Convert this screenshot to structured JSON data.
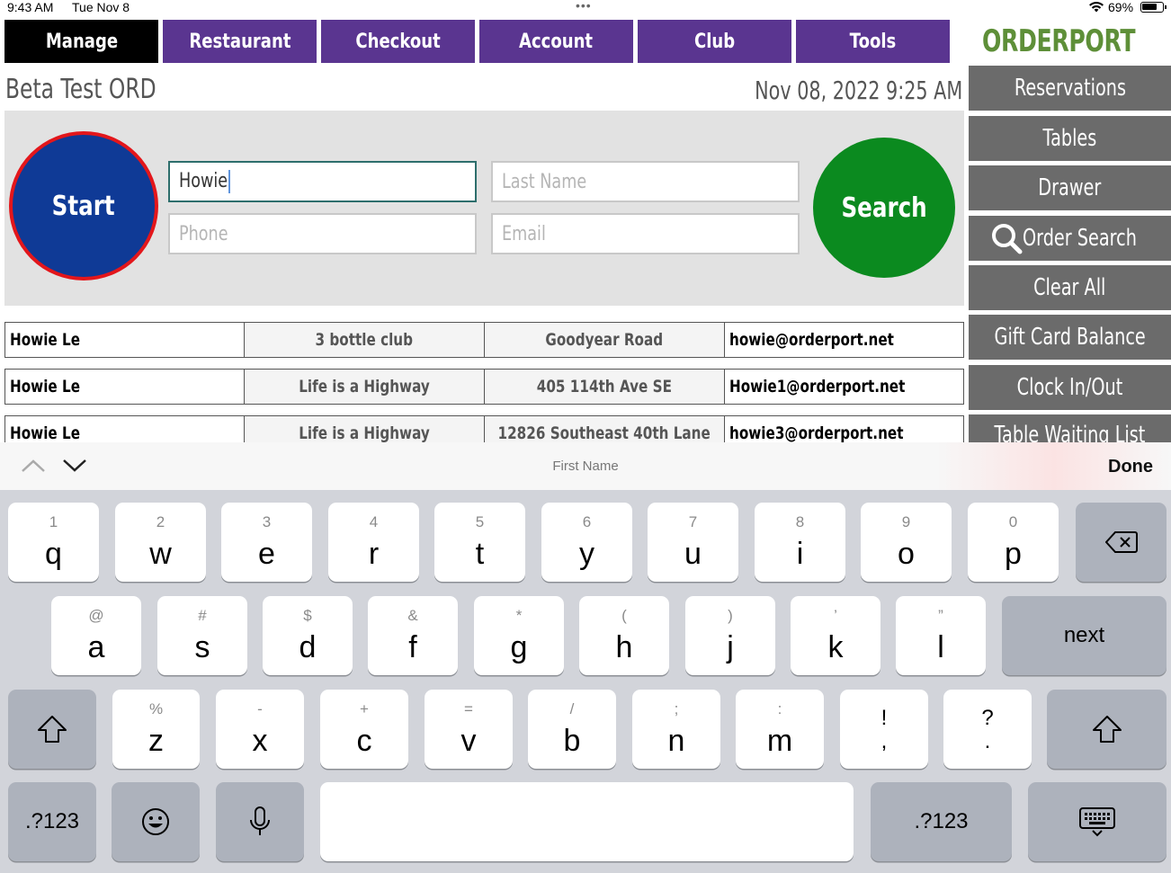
{
  "status_bar": {
    "time": "9:43 AM",
    "date": "Tue Nov 8",
    "battery": "69%"
  },
  "nav": {
    "tabs": [
      "Manage",
      "Restaurant",
      "Checkout",
      "Account",
      "Club",
      "Tools"
    ],
    "active": "Manage"
  },
  "brand": {
    "name": "ORDERPORT",
    "colors": {
      "nav": "#5a3590",
      "logo": "#5e8f38",
      "start": "#0f3a96",
      "search": "#0b8a1f"
    }
  },
  "header": {
    "store_name": "Beta Test ORD",
    "datetime": "Nov 08, 2022 9:25 AM"
  },
  "search": {
    "start_label": "Start",
    "search_label": "Search",
    "first_name_value": "Howie",
    "last_name_placeholder": "Last Name",
    "phone_placeholder": "Phone",
    "email_placeholder": "Email"
  },
  "results": [
    {
      "name": "Howie Le",
      "club": "3 bottle club",
      "address": "Goodyear Road",
      "email": "howie@orderport.net"
    },
    {
      "name": "Howie Le",
      "club": "Life is a Highway",
      "address": "405 114th Ave SE",
      "email": "Howie1@orderport.net"
    },
    {
      "name": "Howie Le",
      "club": "Life is a Highway",
      "address": "12826 Southeast 40th Lane",
      "email": "howie3@orderport.net"
    }
  ],
  "sidebar": {
    "items": [
      {
        "label": "Reservations"
      },
      {
        "label": "Tables"
      },
      {
        "label": "Drawer"
      },
      {
        "label": "Order Search",
        "icon": "search-icon"
      },
      {
        "label": "Clear All"
      },
      {
        "label": "Gift Card Balance"
      },
      {
        "label": "Clock In/Out"
      },
      {
        "label": "Table Waiting List"
      }
    ]
  },
  "keyboard": {
    "accessory_label": "First Name",
    "done_label": "Done",
    "row1": [
      {
        "k": "q",
        "s": "1"
      },
      {
        "k": "w",
        "s": "2"
      },
      {
        "k": "e",
        "s": "3"
      },
      {
        "k": "r",
        "s": "4"
      },
      {
        "k": "t",
        "s": "5"
      },
      {
        "k": "y",
        "s": "6"
      },
      {
        "k": "u",
        "s": "7"
      },
      {
        "k": "i",
        "s": "8"
      },
      {
        "k": "o",
        "s": "9"
      },
      {
        "k": "p",
        "s": "0"
      }
    ],
    "row2": [
      {
        "k": "a",
        "s": "@"
      },
      {
        "k": "s",
        "s": "#"
      },
      {
        "k": "d",
        "s": "$"
      },
      {
        "k": "f",
        "s": "&"
      },
      {
        "k": "g",
        "s": "*"
      },
      {
        "k": "h",
        "s": "("
      },
      {
        "k": "j",
        "s": ")"
      },
      {
        "k": "k",
        "s": "’"
      },
      {
        "k": "l",
        "s": "”"
      }
    ],
    "row3": [
      {
        "k": "z",
        "s": "%"
      },
      {
        "k": "x",
        "s": "-"
      },
      {
        "k": "c",
        "s": "+"
      },
      {
        "k": "v",
        "s": "="
      },
      {
        "k": "b",
        "s": "/"
      },
      {
        "k": "n",
        "s": ";"
      },
      {
        "k": "m",
        "s": ":"
      }
    ],
    "punct1": {
      "top": "!",
      "bottom": ","
    },
    "punct2": {
      "top": "?",
      "bottom": "."
    },
    "next_label": "next",
    "numbers_label": ".?123"
  }
}
